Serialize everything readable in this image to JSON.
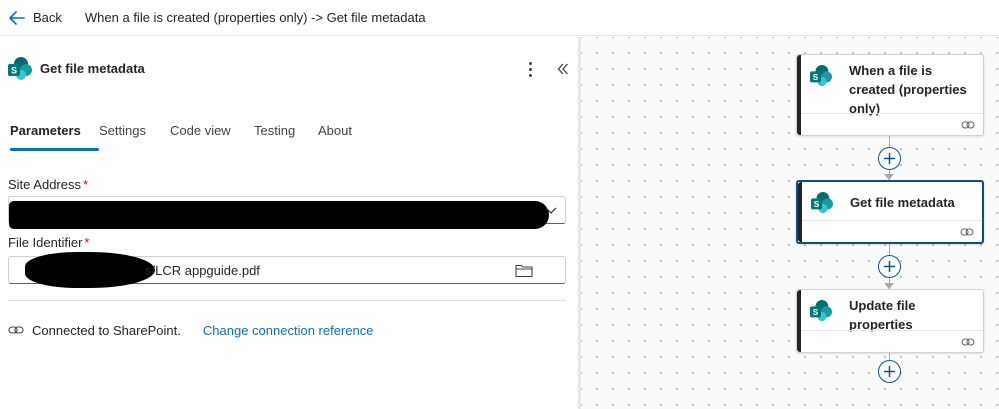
{
  "topbar": {
    "back_label": "Back",
    "breadcrumb": "When a file is created (properties only) -> Get file metadata"
  },
  "panel": {
    "title": "Get file metadata",
    "tabs": [
      {
        "label": "Parameters",
        "active": true
      },
      {
        "label": "Settings",
        "active": false
      },
      {
        "label": "Code view",
        "active": false
      },
      {
        "label": "Testing",
        "active": false
      },
      {
        "label": "About",
        "active": false
      }
    ],
    "site_address": {
      "label": "Site Address",
      "required_mark": "*"
    },
    "file_identifier": {
      "label": "File Identifier",
      "required_mark": "*",
      "value_visible": "s/LCR appguide.pdf"
    },
    "connection": {
      "status": "Connected to SharePoint.",
      "link": "Change connection reference"
    }
  },
  "canvas": {
    "cards": [
      {
        "title": "When a file is created (properties only)",
        "selected": false
      },
      {
        "title": "Get file metadata",
        "selected": true
      },
      {
        "title": "Update file properties",
        "selected": false
      }
    ]
  },
  "colors": {
    "accent": "#0f6cbd",
    "required": "#c50f1f",
    "sharepoint_teal": "#038387"
  }
}
